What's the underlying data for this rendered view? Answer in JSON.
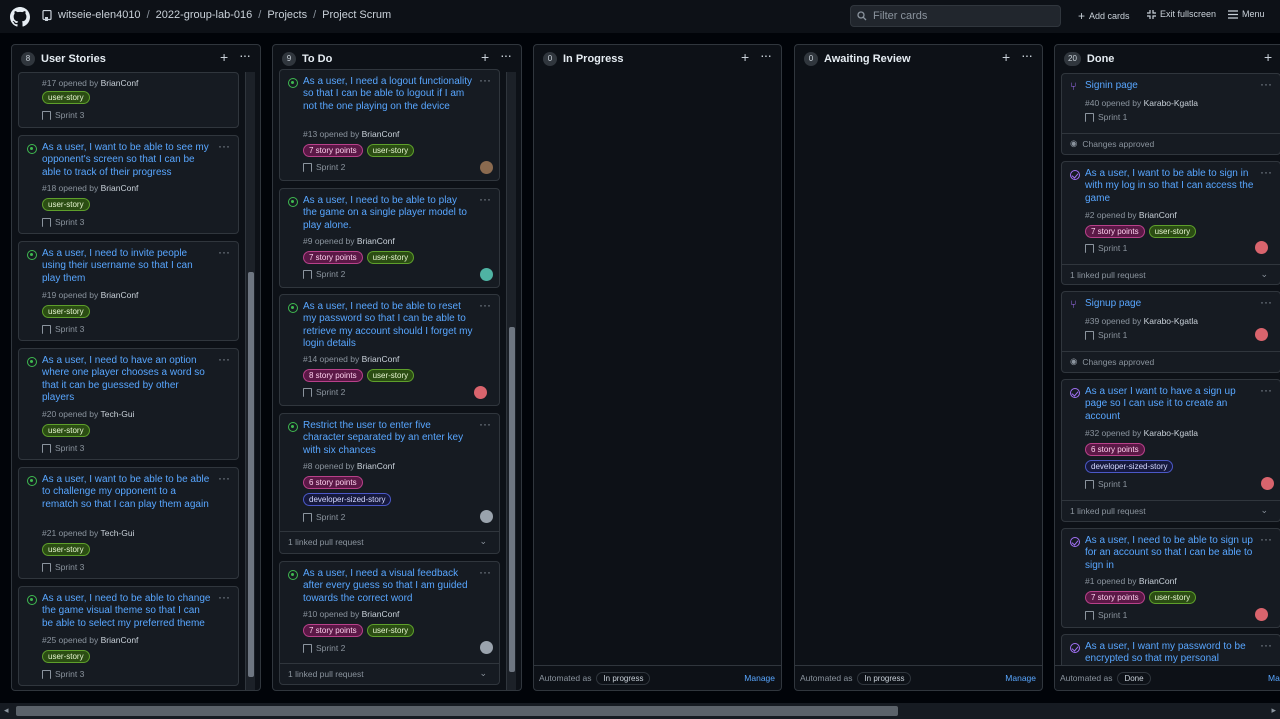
{
  "topbar": {
    "owner": "witseie-elen4010",
    "repo": "2022-group-lab-016",
    "projects": "Projects",
    "project": "Project Scrum",
    "filter_placeholder": "Filter cards",
    "add_cards": "Add cards",
    "exit_fullscreen": "Exit fullscreen",
    "menu": "Menu"
  },
  "columns": [
    {
      "count": "8",
      "title": "User Stories"
    },
    {
      "count": "9",
      "title": "To Do"
    },
    {
      "count": "0",
      "title": "In Progress",
      "automated": "Automated as",
      "pill": "In progress",
      "manage": "Manage"
    },
    {
      "count": "0",
      "title": "Awaiting Review",
      "automated": "Automated as",
      "pill": "In progress",
      "manage": "Manage"
    },
    {
      "count": "20",
      "title": "Done",
      "automated": "Automated as",
      "pill": "Done",
      "manage": "Man"
    }
  ],
  "user_stories": [
    {
      "num": "#17 opened by",
      "author": "BrianConf",
      "label": "user-story",
      "sprint": "Sprint 3"
    },
    {
      "title": "As a user, I want to be able to see my opponent's screen so that I can be able to track of their progress",
      "num": "#18 opened by",
      "author": "BrianConf",
      "label": "user-story",
      "sprint": "Sprint 3"
    },
    {
      "title": "As a user, I need to invite people using their username so that I can play them",
      "num": "#19 opened by",
      "author": "BrianConf",
      "label": "user-story",
      "sprint": "Sprint 3"
    },
    {
      "title": "As a user, I need to have an option where one player chooses a word so that it can be guessed by other players",
      "num": "#20 opened by",
      "author": "Tech-Gui",
      "label": "user-story",
      "sprint": "Sprint 3"
    },
    {
      "title": "As a user, I want to be able to be able to challenge my opponent to a rematch so that I can play them again",
      "num": "#21 opened by",
      "author": "Tech-Gui",
      "label": "user-story",
      "sprint": "Sprint 3"
    },
    {
      "title": "As a user, I need to be able to change the game visual theme so that I can be able to select my preferred theme",
      "num": "#25 opened by",
      "author": "BrianConf",
      "label": "user-story",
      "sprint": "Sprint 3"
    }
  ],
  "todo": [
    {
      "title": "As a user, I need a logout functionality so that I can be able to logout if I am not the one playing on the device",
      "num": "#13 opened by",
      "author": "BrianConf",
      "labels": [
        "7 story points",
        "user-story"
      ],
      "sprint": "Sprint 2"
    },
    {
      "title": "As a user, I need to be able to play the game on a single player model to play alone.",
      "num": "#9 opened by",
      "author": "BrianConf",
      "labels": [
        "7 story points",
        "user-story"
      ],
      "sprint": "Sprint 2"
    },
    {
      "title": "As a user, I need to be able to reset my password so that I can be able to retrieve my account should I forget my login details",
      "num": "#14 opened by",
      "author": "BrianConf",
      "labels": [
        "8 story points",
        "user-story"
      ],
      "sprint": "Sprint 2"
    },
    {
      "title": "Restrict the user to enter five character separated by an enter key with six chances",
      "num": "#8 opened by",
      "author": "BrianConf",
      "labels": [
        "6 story points",
        "developer-sized-story"
      ],
      "sprint": "Sprint 2",
      "footer": "1 linked pull request"
    },
    {
      "title": "As a user, I need a visual feedback after every guess so that I am guided towards the correct word",
      "num": "#10 opened by",
      "author": "BrianConf",
      "labels": [
        "7 story points",
        "user-story"
      ],
      "sprint": "Sprint 2",
      "footer": "1 linked pull request"
    }
  ],
  "done": [
    {
      "title": "Signin page",
      "num": "#40 opened by",
      "author": "Karabo-Kgatla",
      "sprint": "Sprint 1",
      "footer": "Changes approved"
    },
    {
      "title": "As a user, I want to be able to sign in with my log in so that I can access the game",
      "num": "#2 opened by",
      "author": "BrianConf",
      "labels": [
        "7 story points",
        "user-story"
      ],
      "sprint": "Sprint 1",
      "footer": "1 linked pull request"
    },
    {
      "title": "Signup page",
      "num": "#39 opened by",
      "author": "Karabo-Kgatla",
      "sprint": "Sprint 1",
      "footer": "Changes approved"
    },
    {
      "title": "As a user I want to have a sign up page so I can use it to create an account",
      "num": "#32 opened by",
      "author": "Karabo-Kgatla",
      "labels": [
        "6 story points",
        "developer-sized-story"
      ],
      "sprint": "Sprint 1",
      "footer": "1 linked pull request"
    },
    {
      "title": "As a user, I need to be able to sign up for an account so that I can be able to sign in",
      "num": "#1 opened by",
      "author": "BrianConf",
      "labels": [
        "7 story points",
        "user-story"
      ],
      "sprint": "Sprint 1"
    },
    {
      "title": "As a user, I want my password to be encrypted so that my personal"
    }
  ]
}
